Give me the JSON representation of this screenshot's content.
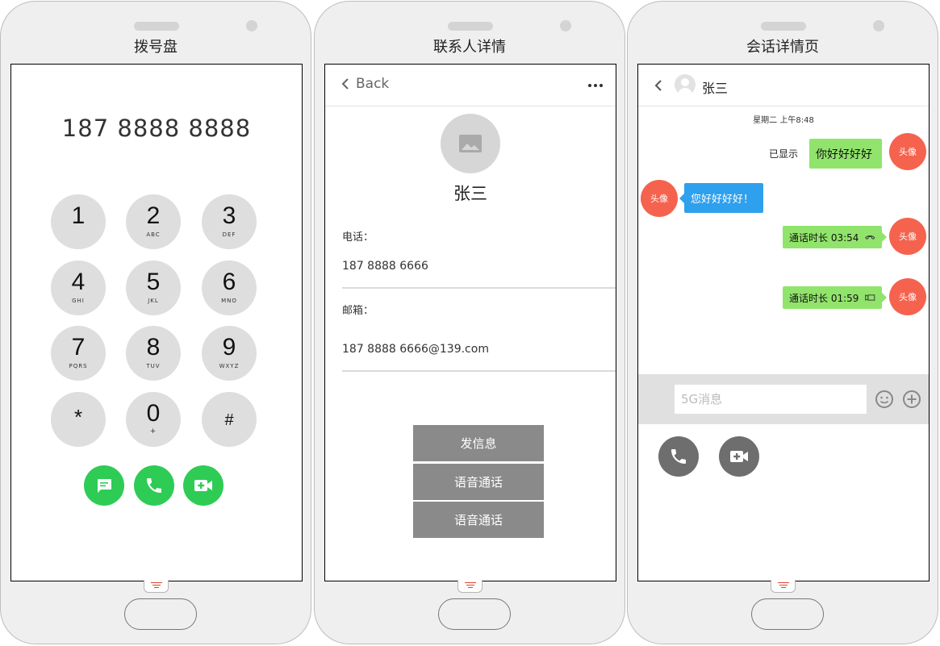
{
  "dialer": {
    "title": "拨号盘",
    "number": "187 8888 8888",
    "keys": [
      {
        "digit": "1",
        "letters": ""
      },
      {
        "digit": "2",
        "letters": "ABC"
      },
      {
        "digit": "3",
        "letters": "DEF"
      },
      {
        "digit": "4",
        "letters": "GHI"
      },
      {
        "digit": "5",
        "letters": "JKL"
      },
      {
        "digit": "6",
        "letters": "MNO"
      },
      {
        "digit": "7",
        "letters": "PQRS"
      },
      {
        "digit": "8",
        "letters": "TUV"
      },
      {
        "digit": "9",
        "letters": "WXYZ"
      },
      {
        "digit": "*",
        "letters": ""
      },
      {
        "digit": "0",
        "letters": "+"
      },
      {
        "digit": "#",
        "letters": ""
      }
    ],
    "actions": [
      "message-icon",
      "phone-icon",
      "video-add-icon"
    ],
    "accent": "#2ecc55"
  },
  "contact": {
    "title": "联系人详情",
    "back_label": "Back",
    "name": "张三",
    "phone_label": "电话：",
    "phone_value": "187 8888 6666",
    "email_label": "邮箱：",
    "email_value": "187 8888 6666@139.com",
    "actions": [
      "发信息",
      "语音通话",
      "语音通话"
    ]
  },
  "chat": {
    "title": "会话详情页",
    "contact_name": "张三",
    "timestamp": "星期二 上午8:48",
    "seen_label": "已显示",
    "avatar_label": "头像",
    "messages": [
      {
        "side": "right",
        "text": "你好好好好"
      },
      {
        "side": "left",
        "text": "您好好好好！"
      },
      {
        "side": "right",
        "text": "通话时长 03:54",
        "icon": "hangup-icon"
      },
      {
        "side": "right",
        "text": "通话时长 01:59",
        "icon": "video-call-icon"
      }
    ],
    "input_placeholder": "5G消息",
    "colors": {
      "avatar": "#f5634e",
      "sent": "#91e46b",
      "received": "#2ea0ee"
    }
  }
}
